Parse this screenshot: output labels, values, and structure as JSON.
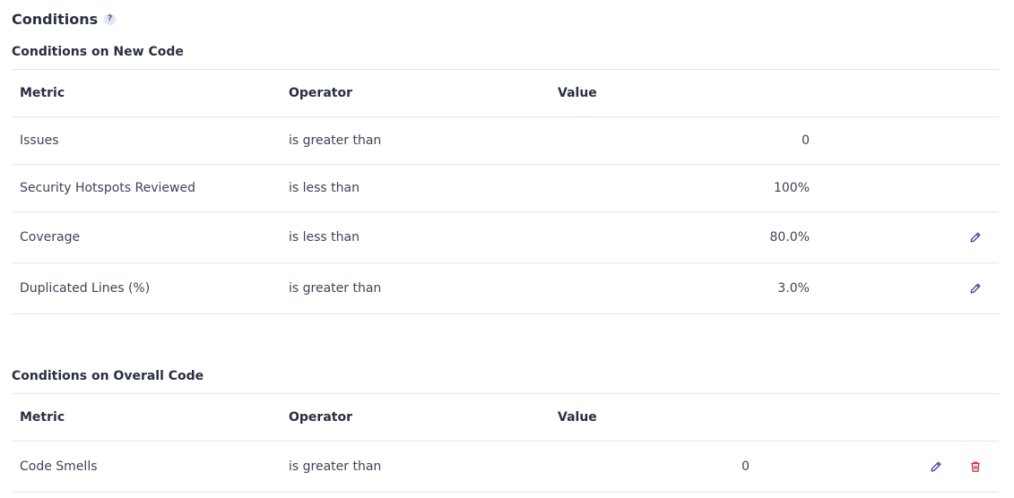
{
  "header": {
    "title": "Conditions",
    "help": "?"
  },
  "new_code": {
    "title": "Conditions on New Code",
    "columns": {
      "metric": "Metric",
      "operator": "Operator",
      "value": "Value"
    },
    "rows": [
      {
        "metric": "Issues",
        "operator": "is greater than",
        "value": "0",
        "editable": false
      },
      {
        "metric": "Security Hotspots Reviewed",
        "operator": "is less than",
        "value": "100%",
        "editable": false
      },
      {
        "metric": "Coverage",
        "operator": "is less than",
        "value": "80.0%",
        "editable": true
      },
      {
        "metric": "Duplicated Lines (%)",
        "operator": "is greater than",
        "value": "3.0%",
        "editable": true
      }
    ]
  },
  "overall_code": {
    "title": "Conditions on Overall Code",
    "columns": {
      "metric": "Metric",
      "operator": "Operator",
      "value": "Value"
    },
    "rows": [
      {
        "metric": "Code Smells",
        "operator": "is greater than",
        "value": "0",
        "editable": true,
        "deletable": true
      }
    ]
  },
  "icons": {
    "help": "help-icon",
    "edit": "pencil-icon",
    "delete": "trash-icon"
  },
  "colors": {
    "edit_icon": "#3e43a1",
    "delete_icon": "#d02f3a",
    "border": "#e1e6f3"
  }
}
